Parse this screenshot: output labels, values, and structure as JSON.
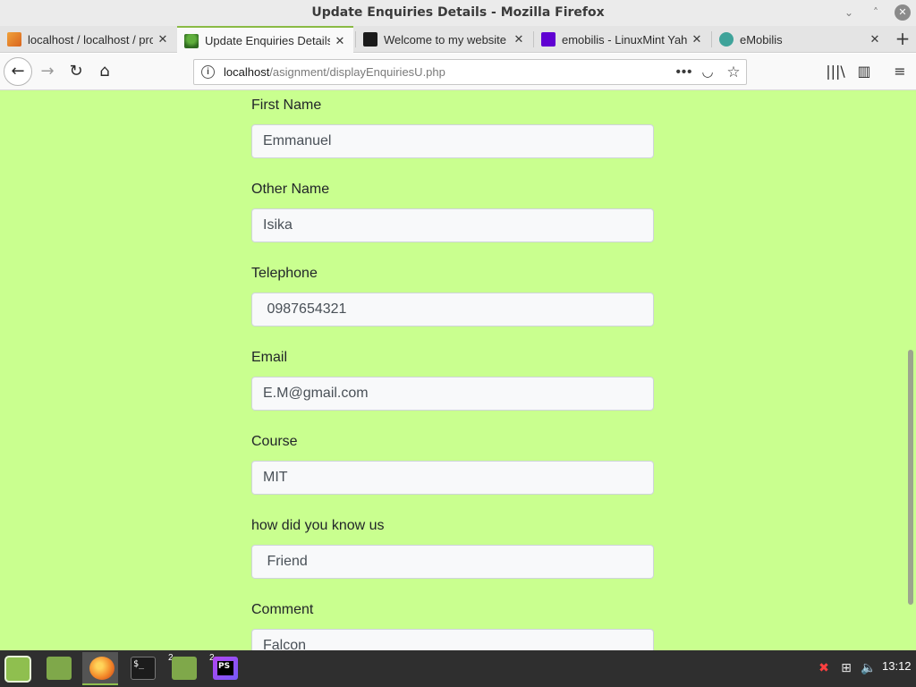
{
  "window": {
    "title": "Update Enquiries Details - Mozilla Firefox",
    "minimize_glyph": "⌄",
    "maximize_glyph": "˄",
    "close_glyph": "✕"
  },
  "tabs": [
    {
      "label": "localhost / localhost / pro",
      "icon": "phpmyadmin-icon",
      "color": "#e8822a"
    },
    {
      "label": "Update Enquiries Details",
      "icon": "site-favicon-icon",
      "color": "#3d8a2b"
    },
    {
      "label": "Welcome to my website",
      "icon": "site-favicon-icon",
      "color": "#1a1a1a"
    },
    {
      "label": "emobilis - LinuxMint Yaho",
      "icon": "yahoo-icon",
      "color": "#6001d2"
    },
    {
      "label": "eMobilis",
      "icon": "globe-icon",
      "color": "#3fa39a"
    }
  ],
  "tab_close_glyph": "✕",
  "new_tab_glyph": "+",
  "navbar": {
    "back_glyph": "←",
    "forward_glyph": "→",
    "reload_glyph": "↻",
    "home_glyph": "⌂",
    "url_host": "localhost",
    "url_path": "/asignment/displayEnquiriesU.php",
    "info_glyph": "i",
    "more_glyph": "•••",
    "pocket_glyph": "◡",
    "star_glyph": "☆",
    "library_glyph": "|||\\",
    "sidebar_glyph": "▥",
    "menu_glyph": "≡"
  },
  "form": {
    "fields": [
      {
        "label": "First Name",
        "value": "Emmanuel"
      },
      {
        "label": "Other Name",
        "value": "Isika"
      },
      {
        "label": "Telephone",
        "value": " 0987654321"
      },
      {
        "label": "Email",
        "value": "E.M@gmail.com"
      },
      {
        "label": "Course",
        "value": "MIT"
      },
      {
        "label": "how did you know us",
        "value": " Friend"
      },
      {
        "label": "Comment",
        "value": "Falcon"
      }
    ]
  },
  "taskbar": {
    "items": [
      {
        "name": "menu",
        "icon": "linux-mint-menu-icon",
        "color": "#8fbf4f"
      },
      {
        "name": "files",
        "icon": "folder-icon",
        "color": "#7fa84a"
      },
      {
        "name": "firefox",
        "icon": "firefox-icon",
        "color": "#f38a2a"
      },
      {
        "name": "terminal",
        "icon": "terminal-icon",
        "color": "#1c1c1c"
      },
      {
        "name": "files-2",
        "icon": "folder-icon",
        "color": "#7fa84a",
        "badge": "2"
      },
      {
        "name": "phpstorm",
        "icon": "phpstorm-icon",
        "color": "#9b3ed6",
        "badge": "2"
      }
    ],
    "terminal_glyph": "$_",
    "phpstorm_glyph": "PS",
    "tray_shield_glyph": "✖",
    "tray_network_glyph": "⊞",
    "tray_volume_glyph": "🔈",
    "clock": "13:12"
  }
}
